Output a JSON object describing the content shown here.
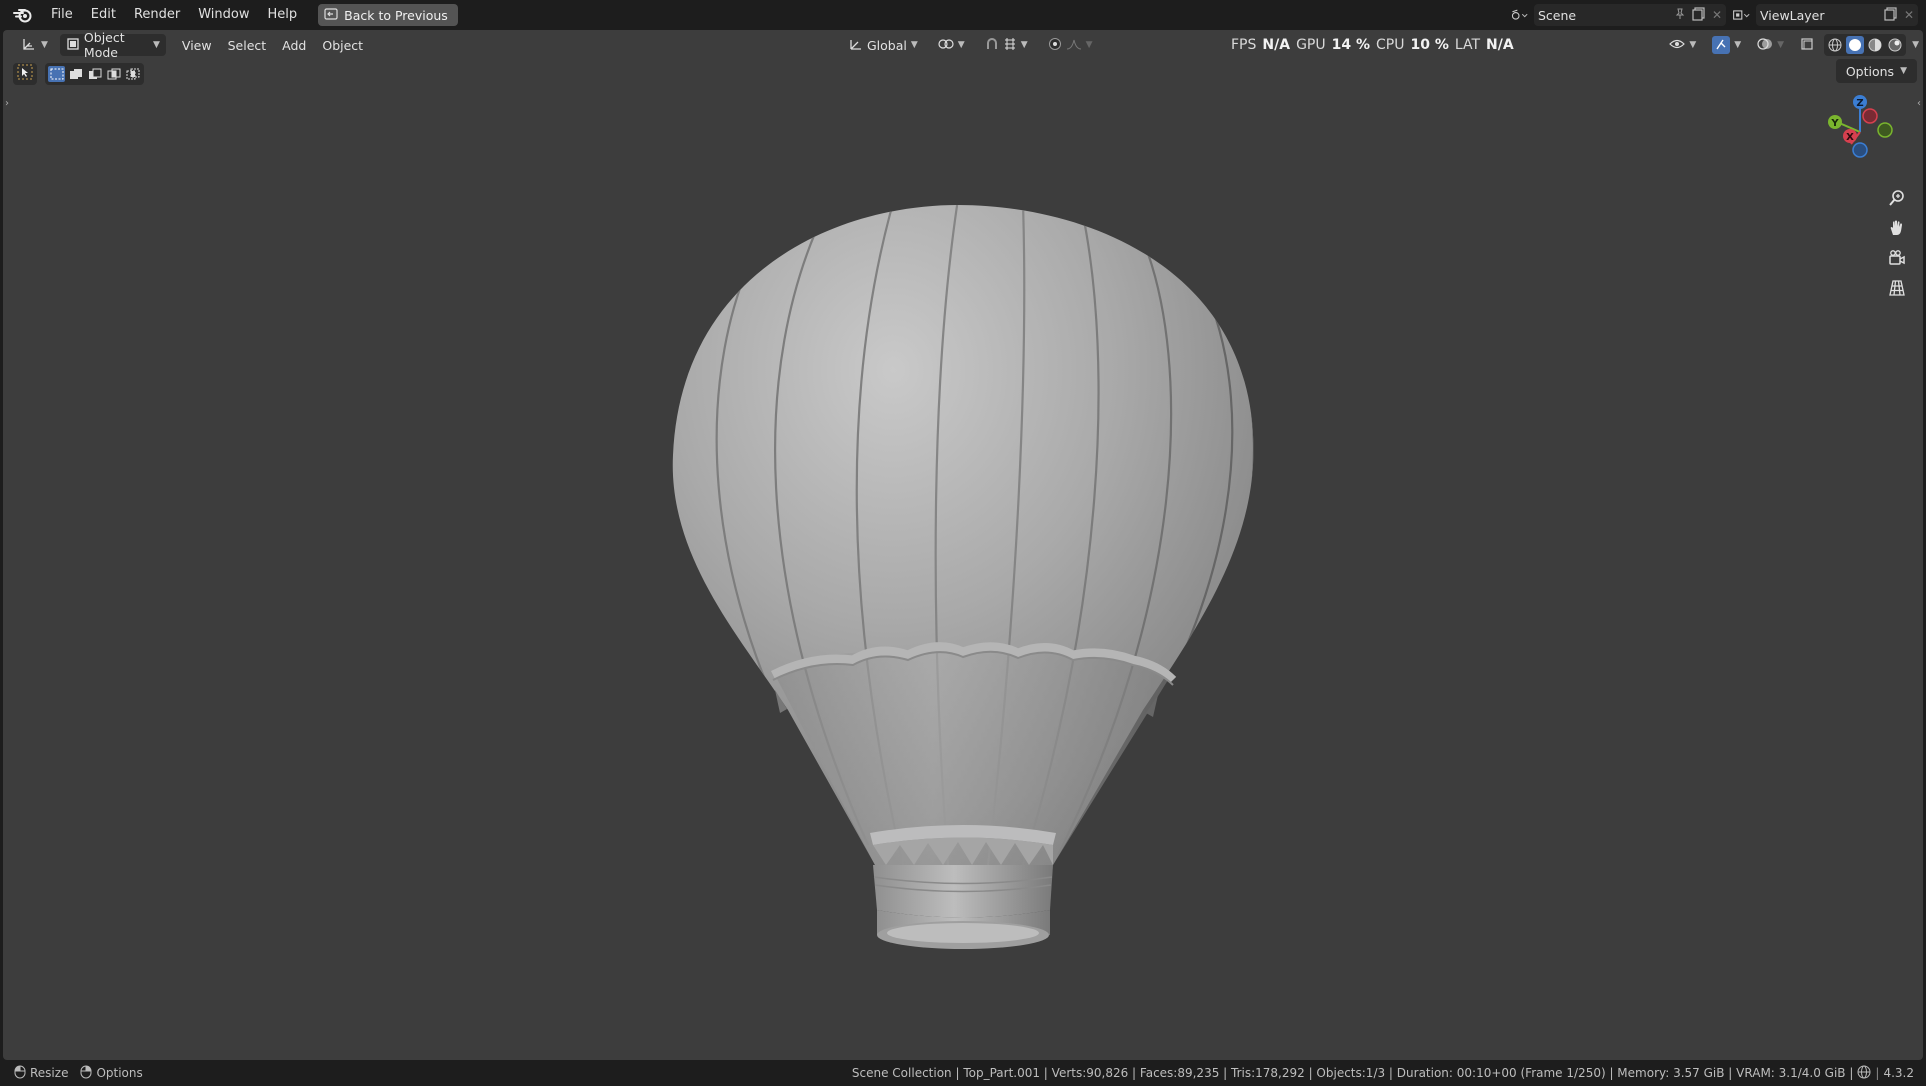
{
  "menu": {
    "items": [
      "File",
      "Edit",
      "Render",
      "Window",
      "Help"
    ],
    "back_label": "Back to Previous"
  },
  "scene": {
    "name": "Scene"
  },
  "view_layer": {
    "name": "ViewLayer"
  },
  "viewport_header": {
    "mode": "Object Mode",
    "menus": [
      "View",
      "Select",
      "Add",
      "Object"
    ],
    "orientation": "Global"
  },
  "stats": {
    "fps_label": "FPS",
    "fps_value": "N/A",
    "gpu_label": "GPU",
    "gpu_value": "14 %",
    "cpu_label": "CPU",
    "cpu_value": "10 %",
    "lat_label": "LAT",
    "lat_value": "N/A"
  },
  "options_label": "Options",
  "gizmo": {
    "x": "X",
    "y": "Y",
    "z": "Z"
  },
  "statusbar": {
    "resize_label": "Resize",
    "options_label": "Options",
    "info": "Scene Collection | Top_Part.001 | Verts:90,826 | Faces:89,235 | Tris:178,292 | Objects:1/3 | Duration: 00:10+00 (Frame 1/250) | Memory: 3.57 GiB | VRAM: 3.1/4.0 GiB |",
    "version": "4.3.2"
  },
  "colors": {
    "accent": "#4772b3",
    "viewport_bg": "#3d3d3d",
    "axis_x": "#d6404f",
    "axis_y": "#7ab52e",
    "axis_z": "#3b7ed4"
  }
}
